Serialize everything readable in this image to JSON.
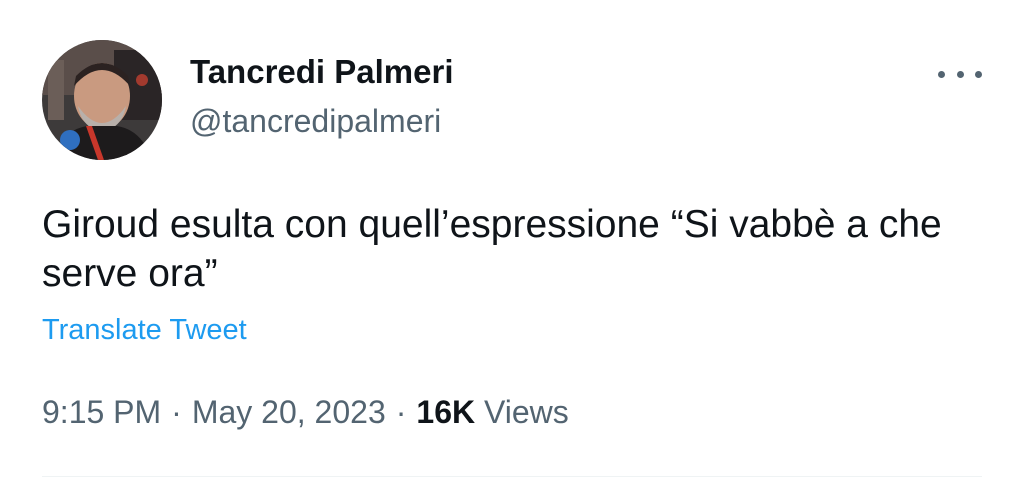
{
  "author": {
    "name": "Tancredi Palmeri",
    "handle": "@tancredipalmeri",
    "avatar": "profile-photo"
  },
  "more_icon": "more-horizontal-icon",
  "tweet": {
    "text": "Giroud esulta con quell’espressione “Si vabbè a che serve ora”",
    "translate_label": "Translate Tweet"
  },
  "meta": {
    "time": "9:15 PM",
    "separator": "·",
    "date": "May 20, 2023",
    "views_count": "16K",
    "views_label": "Views"
  },
  "colors": {
    "text": "#0f1419",
    "secondary": "#536471",
    "link": "#1d9bf0"
  }
}
